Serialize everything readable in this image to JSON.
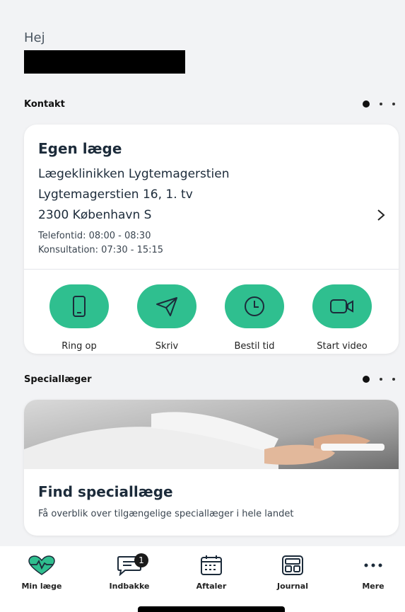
{
  "greeting": "Hej",
  "contact": {
    "section_title": "Kontakt",
    "card": {
      "heading": "Egen læge",
      "clinic_name": "Lægeklinikken Lygtemagerstien",
      "address_line1": "Lygtemagerstien 16, 1. tv",
      "address_line2": "2300 København S",
      "phone_hours": "Telefontid: 08:00 - 08:30",
      "consult_hours": "Konsultation: 07:30 - 15:15",
      "actions": [
        {
          "label": "Ring op",
          "icon": "phone-icon"
        },
        {
          "label": "Skriv",
          "icon": "send-icon"
        },
        {
          "label": "Bestil tid",
          "icon": "clock-icon"
        },
        {
          "label": "Start video",
          "icon": "video-icon"
        }
      ]
    }
  },
  "specialists": {
    "section_title": "Speciallæger",
    "card": {
      "heading": "Find speciallæge",
      "description": "Få overblik over tilgængelige speciallæger i hele landet"
    }
  },
  "nav": {
    "items": [
      {
        "label": "Min læge",
        "icon": "heart-pulse-icon"
      },
      {
        "label": "Indbakke",
        "icon": "message-icon",
        "badge": "1"
      },
      {
        "label": "Aftaler",
        "icon": "calendar-icon"
      },
      {
        "label": "Journal",
        "icon": "journal-icon"
      },
      {
        "label": "Mere",
        "icon": "more-icon"
      }
    ]
  },
  "colors": {
    "accent": "#2fbf8f",
    "background": "#f2f3f5"
  }
}
